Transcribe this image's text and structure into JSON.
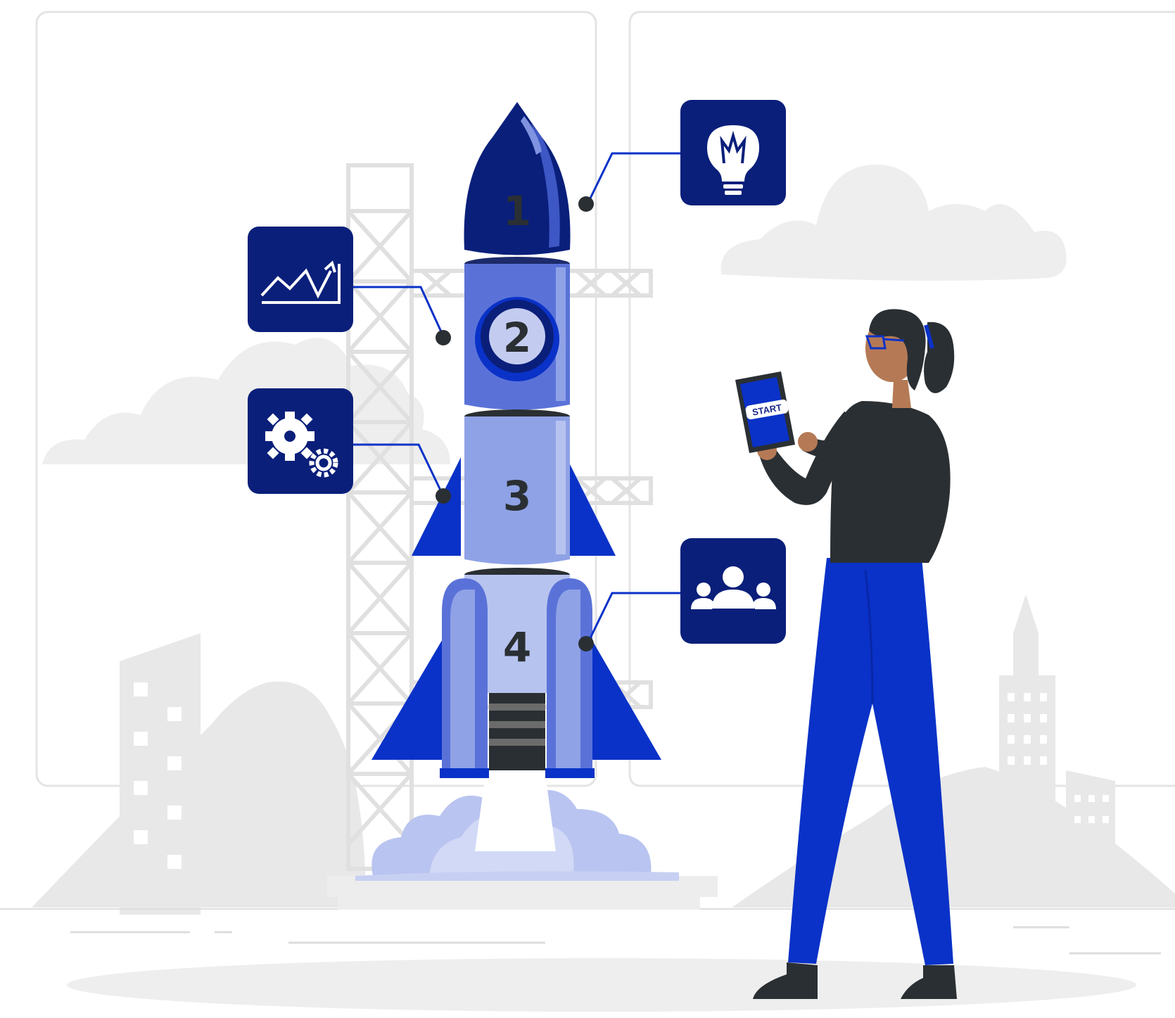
{
  "colors": {
    "navy": "#0a1f7a",
    "blue": "#0a32c8",
    "mid_blue": "#5a72d8",
    "light_blue": "#8fa2e6",
    "pale_blue": "#c3ccf0",
    "dark": "#2a2f33",
    "gray_bg": "#e9e9e9",
    "outline": "#e2e2e2"
  },
  "rocket": {
    "stages": [
      {
        "label": "1",
        "icon": "lightbulb-icon"
      },
      {
        "label": "2",
        "icon": "trend-chart-icon"
      },
      {
        "label": "3",
        "icon": "gears-icon"
      },
      {
        "label": "4",
        "icon": "team-icon"
      }
    ]
  },
  "tablet": {
    "button_label": "START"
  }
}
